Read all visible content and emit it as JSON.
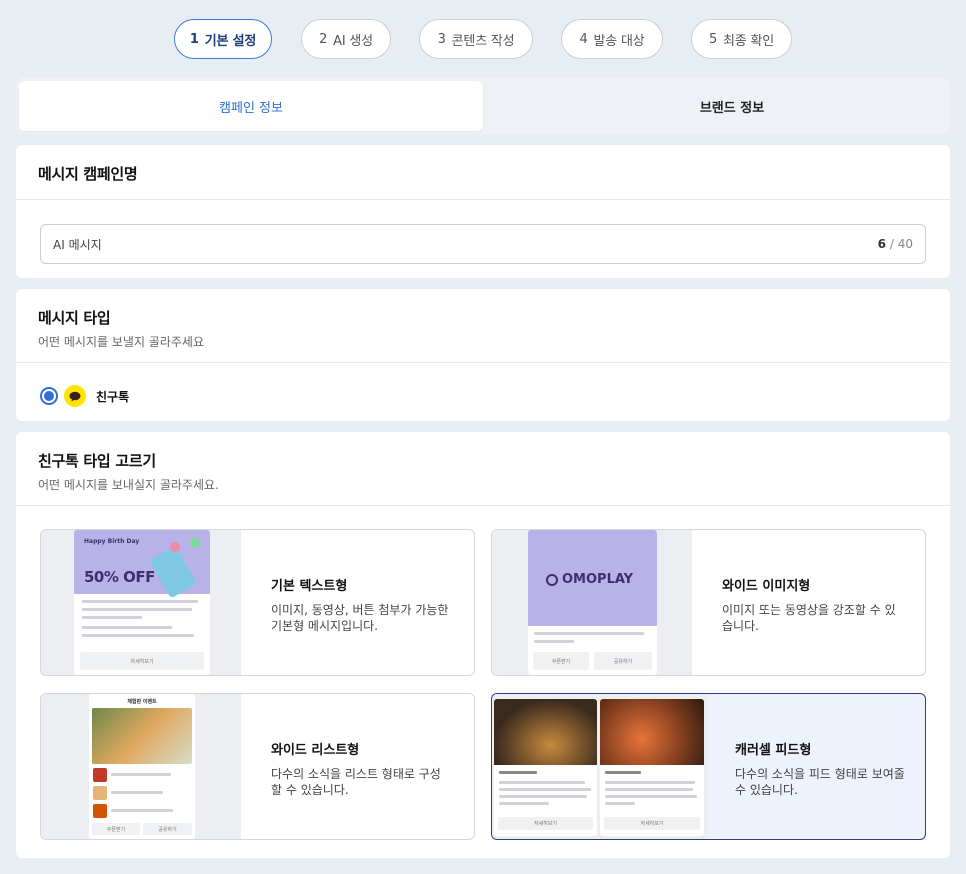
{
  "stepper": {
    "steps": [
      {
        "num": "1",
        "label": "기본 설정"
      },
      {
        "num": "2",
        "label": "AI 생성"
      },
      {
        "num": "3",
        "label": "콘텐츠 작성"
      },
      {
        "num": "4",
        "label": "발송 대상"
      },
      {
        "num": "5",
        "label": "최종 확인"
      }
    ],
    "active_index": 0
  },
  "tabs": {
    "campaign": "캠페인 정보",
    "brand": "브랜드 정보"
  },
  "campaign_name": {
    "title": "메시지 캠페인명",
    "value": "AI 메시지",
    "count": "6",
    "max": "/ 40"
  },
  "message_type": {
    "title": "메시지 타입",
    "subtitle": "어떤 메시지를 보낼지 골라주세요",
    "option_label": "친구톡"
  },
  "friendtalk_type": {
    "title": "친구톡 타입 고르기",
    "subtitle": "어떤 메시지를 보내실지 골라주세요.",
    "options": [
      {
        "title": "기본 텍스트형",
        "desc": "이미지, 동영상, 버튼 첨부가 가능한 기본형 메시지입니다.",
        "preview": {
          "heading": "Happy Birth Day",
          "banner": "50% OFF",
          "button": "자세히보기"
        }
      },
      {
        "title": "와이드 이미지형",
        "desc": "이미지 또는 동영상을 강조할 수 있습니다.",
        "preview": {
          "brand": "OMOPLAY",
          "buttons": [
            "쿠폰받기",
            "공유하기"
          ]
        }
      },
      {
        "title": "와이드 리스트형",
        "desc": "다수의 소식을 리스트 형태로 구성할 수 있습니다.",
        "preview": {
          "heading": "체험판 이벤트",
          "buttons": [
            "쿠폰받기",
            "공유하기"
          ]
        }
      },
      {
        "title": "캐러셀 피드형",
        "desc": "다수의 소식을 피드 형태로 보여줄 수 있습니다.",
        "preview": {
          "buttons": [
            "자세히보기",
            "자세히보기"
          ]
        }
      }
    ],
    "selected_index": 3
  },
  "colors": {
    "accent": "#2f6fd6",
    "kakao_yellow": "#fee500",
    "selected_border": "#2c3e8f",
    "page_bg": "#e8edf3"
  }
}
